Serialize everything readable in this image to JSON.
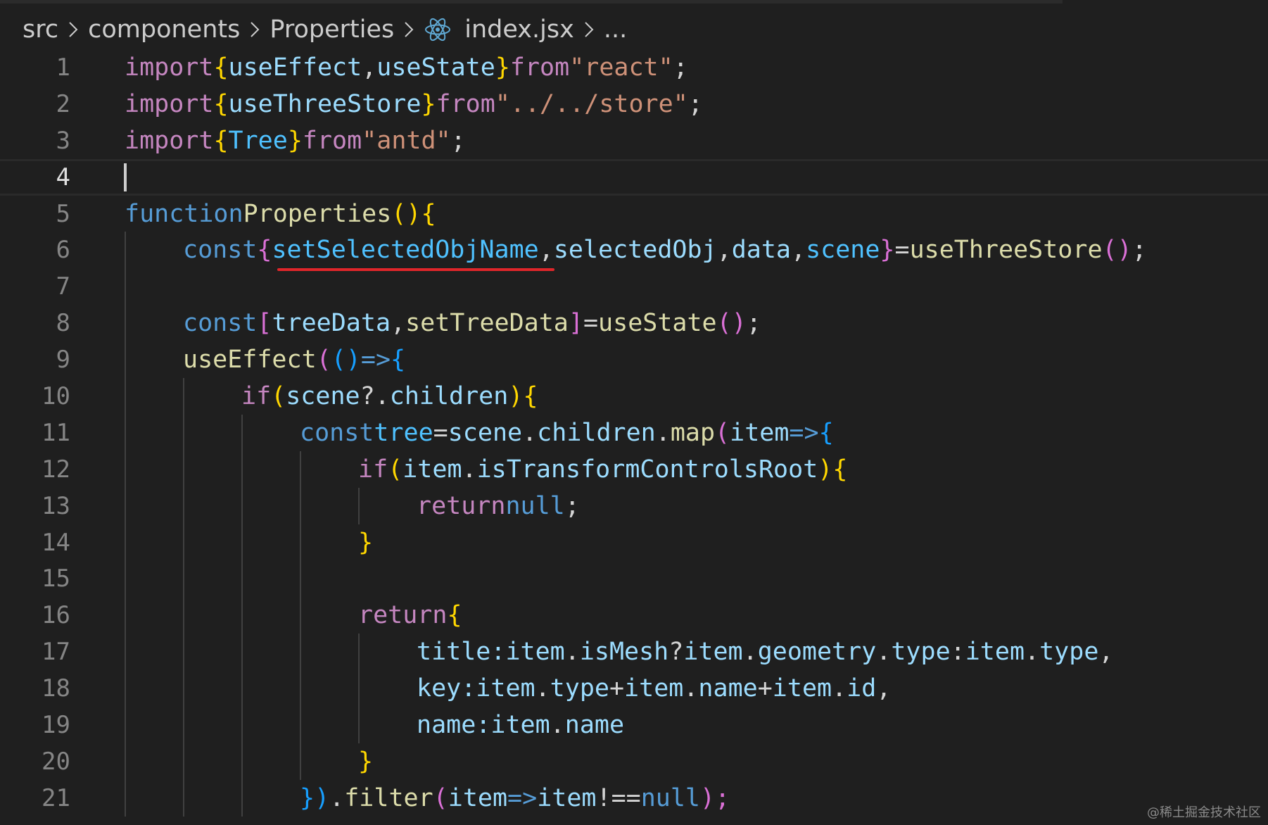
{
  "breadcrumb": {
    "items": [
      "src",
      "components",
      "Properties"
    ],
    "file": "index.jsx",
    "ellipsis": "..."
  },
  "line_numbers": [
    "1",
    "2",
    "3",
    "4",
    "5",
    "6",
    "7",
    "8",
    "9",
    "10",
    "11",
    "12",
    "13",
    "14",
    "15",
    "16",
    "17",
    "18",
    "19",
    "20",
    "21"
  ],
  "code": {
    "l1": [
      "import",
      "{",
      "useEffect",
      ",",
      "useState",
      "}",
      "from",
      "\"react\"",
      ";"
    ],
    "l2": [
      "import",
      "{",
      "useThreeStore",
      "}",
      "from",
      "\"../../store\"",
      ";"
    ],
    "l3": [
      "import",
      "{",
      "Tree",
      "}",
      "from",
      "\"antd\"",
      ";"
    ],
    "l5": [
      "function",
      "Properties",
      "()",
      "{"
    ],
    "l6": [
      "const",
      "{",
      "setSelectedObjName",
      ",",
      "selectedObj",
      ",",
      "data",
      ",",
      "scene",
      "}",
      "=",
      "useThreeStore",
      "()",
      ";"
    ],
    "l8": [
      "const",
      "[",
      "treeData",
      ",",
      "setTreeData",
      "]",
      "=",
      "useState",
      "()",
      ";"
    ],
    "l9": [
      "useEffect",
      "(",
      "()",
      "=>",
      "{"
    ],
    "l10": [
      "if",
      "(",
      "scene",
      "?.",
      "children",
      ")",
      "{"
    ],
    "l11": [
      "const",
      "tree",
      "=",
      "scene",
      ".",
      "children",
      ".",
      "map",
      "(",
      "item",
      "=>",
      "{"
    ],
    "l12": [
      "if",
      "(",
      "item",
      ".",
      "isTransformControlsRoot",
      ")",
      "{"
    ],
    "l13": [
      "return",
      "null",
      ";"
    ],
    "l14": [
      "}"
    ],
    "l16": [
      "return",
      "{"
    ],
    "l17": [
      "title",
      ":",
      "item",
      ".",
      "isMesh",
      "?",
      "item",
      ".",
      "geometry",
      ".",
      "type",
      ":",
      "item",
      ".",
      "type",
      ","
    ],
    "l18": [
      "key",
      ":",
      "item",
      ".",
      "type",
      "+",
      "item",
      ".",
      "name",
      "+",
      "item",
      ".",
      "id",
      ","
    ],
    "l19": [
      "name",
      ":",
      "item",
      ".",
      "name"
    ],
    "l20": [
      "}"
    ],
    "l21": [
      "})",
      ".",
      "filter",
      "(",
      "item",
      "=>",
      "item",
      "!==",
      "null",
      ");"
    ]
  },
  "watermark": "@稀土掘金技术社区",
  "colors": {
    "background": "#1f1f1f",
    "keyword": "#c586c0",
    "storage": "#569cd6",
    "variable": "#9cdcfe",
    "constant": "#4fc1ff",
    "function": "#dcdcaa",
    "string": "#ce9178",
    "highlight_underline": "#e0262a"
  }
}
